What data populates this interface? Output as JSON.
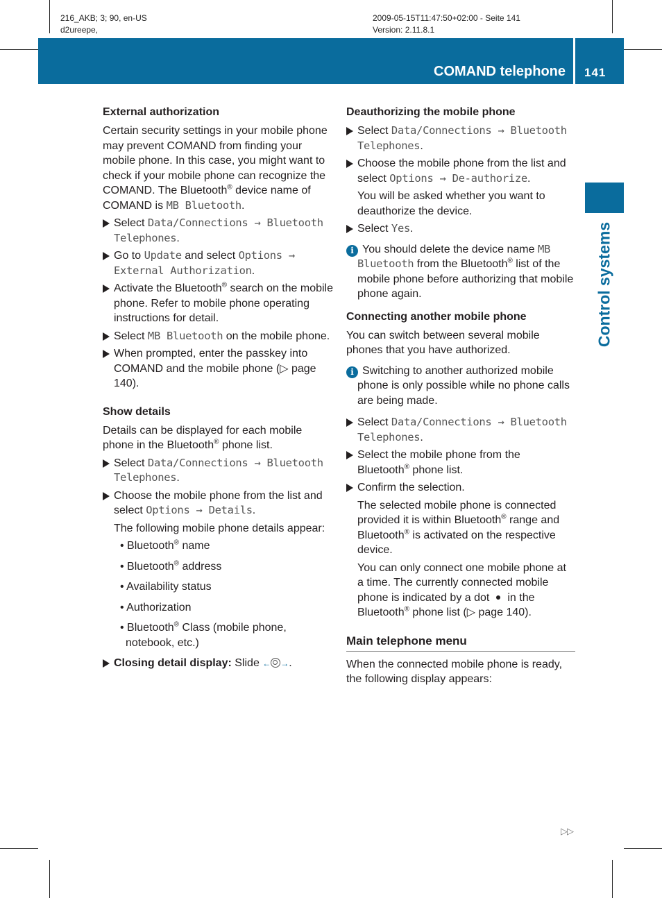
{
  "meta": {
    "left_line1": "216_AKB; 3; 90, en-US",
    "left_line2": "d2ureepe,",
    "right_line1": "2009-05-15T11:47:50+02:00 - Seite 141",
    "right_line2": "Version: 2.11.8.1"
  },
  "header": {
    "section_title": "COMAND telephone",
    "page_number": "141",
    "side_tab_label": "Control systems",
    "accent_color": "#0a6c9d"
  },
  "left": {
    "ext_auth": {
      "heading": "External authorization",
      "intro_a": "Certain security settings in your mobile phone may prevent COMAND from finding your mobile phone. In this case, you might want to check if your mobile phone can recognize the COMAND. The Bluetooth",
      "intro_b": " device name of COMAND is ",
      "intro_code": "MB Bluetooth",
      "step1_pre": "Select ",
      "step1_code": "Data/Connections → Bluetooth Telephones",
      "step2_pre": "Go to ",
      "step2_code1": "Update",
      "step2_mid": " and select ",
      "step2_code2": "Options → External Authorization",
      "step3_a": "Activate the Bluetooth",
      "step3_b": " search on the mobile phone. Refer to mobile phone operating instructions for detail.",
      "step4_pre": "Select ",
      "step4_code": "MB Bluetooth",
      "step4_post": " on the mobile phone.",
      "step5": "When prompted, enter the passkey into COMAND and the mobile phone (▷ page 140)."
    },
    "show_details": {
      "heading": "Show details",
      "intro_a": "Details can be displayed for each mobile phone in the Bluetooth",
      "intro_b": " phone list.",
      "step1_pre": "Select ",
      "step1_code": "Data/Connections → Bluetooth Telephones",
      "step2_pre": "Choose the mobile phone from the list and select ",
      "step2_code": "Options → Details",
      "step2_sub": "The following mobile phone details appear:",
      "details": [
        {
          "a": "Bluetooth",
          "b": " name"
        },
        {
          "a": "Bluetooth",
          "b": " address"
        },
        {
          "a": "Availability status",
          "b": ""
        },
        {
          "a": "Authorization",
          "b": ""
        },
        {
          "a": "Bluetooth",
          "b": " Class (mobile phone, notebook, etc.)"
        }
      ],
      "close_bold": "Closing detail display:",
      "close_text": " Slide "
    }
  },
  "right": {
    "deauth": {
      "heading": "Deauthorizing the mobile phone",
      "step1_pre": "Select ",
      "step1_code": "Data/Connections → Bluetooth Telephones",
      "step2_pre": "Choose the mobile phone from the list and select ",
      "step2_code": "Options → De-authorize",
      "step2_sub": "You will be asked whether you want to deauthorize the device.",
      "step3_pre": "Select ",
      "step3_code": "Yes",
      "info_pre": "You should delete the device name ",
      "info_code": "MB Bluetooth",
      "info_a": " from the Bluetooth",
      "info_b": " list of the mobile phone before authorizing that mobile phone again."
    },
    "connect": {
      "heading": "Connecting another mobile phone",
      "intro": "You can switch between several mobile phones that you have authorized.",
      "info": "Switching to another authorized mobile phone is only possible while no phone calls are being made.",
      "step1_pre": "Select ",
      "step1_code": "Data/Connections → Bluetooth Telephones",
      "step2_a": "Select the mobile phone from the Bluetooth",
      "step2_b": " phone list.",
      "step3": "Confirm the selection.",
      "step3_sub_a": "The selected mobile phone is connected provided it is within Bluetooth",
      "step3_sub_b": " range and Bluetooth",
      "step3_sub_c": " is activated on the respective device.",
      "step3_sub2_a": "You can only connect one mobile phone at a time. The currently connected mobile phone is indicated by a dot",
      "step3_sub2_b": "in the Bluetooth",
      "step3_sub2_c": " phone list (▷ page 140)."
    },
    "main_menu": {
      "heading": "Main telephone menu",
      "intro": "When the connected mobile phone is ready, the following display appears:"
    }
  },
  "footer": {
    "continue_marker": "▷▷"
  },
  "symbols": {
    "registered": "®",
    "period": ".",
    "bullet": "• ",
    "info_icon": "i",
    "arrow_left": "←",
    "arrow_right": "→"
  }
}
